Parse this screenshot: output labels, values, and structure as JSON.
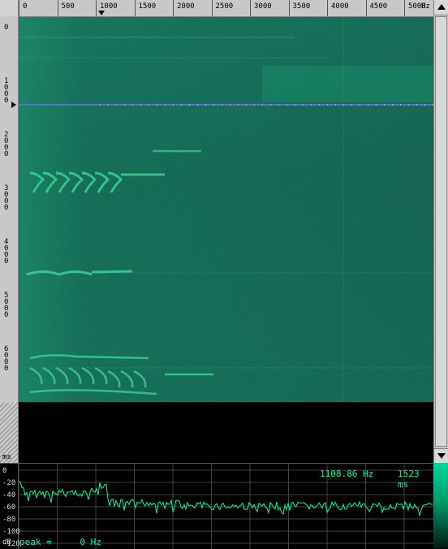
{
  "freq_axis": {
    "unit": "Hz",
    "ticks": [
      "0",
      "500",
      "1000",
      "1500",
      "2000",
      "2500",
      "3000",
      "3500",
      "4000",
      "4500",
      "5000"
    ]
  },
  "time_axis": {
    "unit": "ms",
    "ticks": [
      "0",
      "1000",
      "2000",
      "3000",
      "4000",
      "5000",
      "6000"
    ]
  },
  "readout": {
    "frequency": "1108.86 Hz",
    "time": "1523 ms",
    "peak_label": "peak =",
    "peak_value": "0 Hz"
  },
  "db_axis": {
    "unit": "dB",
    "ticks": [
      "0",
      "-20",
      "-40",
      "-60",
      "-80",
      "-100",
      "-120"
    ]
  },
  "colors": {
    "spectro_bg": "#0b5a45",
    "spectro_band": "#19916a",
    "cursor_line": "#5a6fd0",
    "curve": "#00ff9a",
    "grid": "#444444"
  }
}
